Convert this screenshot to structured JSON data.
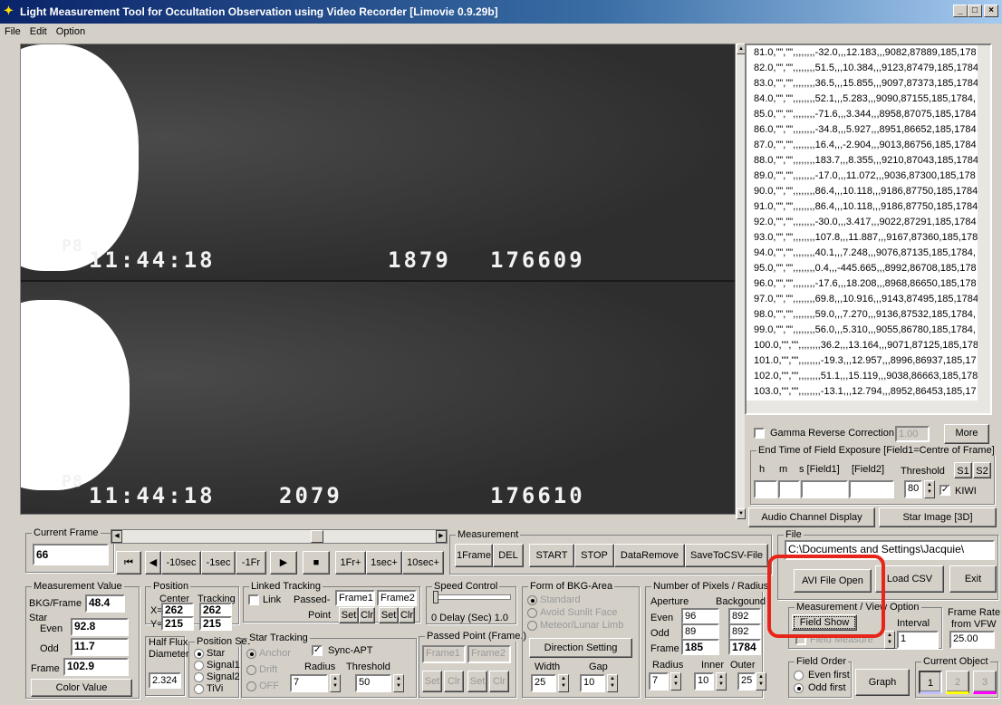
{
  "window": {
    "title": "Light Measurement Tool for Occultation Observation using Video Recorder [Limovie 0.9.29b]"
  },
  "menu": [
    "File",
    "Edit",
    "Option"
  ],
  "video": {
    "top": {
      "label": "P8",
      "time": "11:44:18",
      "n1": "1879",
      "n2": "176609"
    },
    "bottom": {
      "label": "P8",
      "time": "11:44:18",
      "n1": "2079",
      "n2": "176610"
    }
  },
  "log_rows": [
    "81.0,\"\",\"\",,,,,,,,-32.0,,,12.183,,,9082,87889,185,178",
    "82.0,\"\",\"\",,,,,,,,51.5,,,10.384,,,9123,87479,185,1784",
    "83.0,\"\",\"\",,,,,,,,36.5,,,15.855,,,9097,87373,185,1784",
    "84.0,\"\",\"\",,,,,,,,52.1,,,5.283,,,9090,87155,185,1784,",
    "85.0,\"\",\"\",,,,,,,,-71.6,,,3.344,,,8958,87075,185,1784",
    "86.0,\"\",\"\",,,,,,,,-34.8,,,5.927,,,8951,86652,185,1784",
    "87.0,\"\",\"\",,,,,,,,16.4,,,-2.904,,,9013,86756,185,1784",
    "88.0,\"\",\"\",,,,,,,,183.7,,,8.355,,,9210,87043,185,1784",
    "89.0,\"\",\"\",,,,,,,,-17.0,,,11.072,,,9036,87300,185,178",
    "90.0,\"\",\"\",,,,,,,,86.4,,,10.118,,,9186,87750,185,1784",
    "91.0,\"\",\"\",,,,,,,,86.4,,,10.118,,,9186,87750,185,1784",
    "92.0,\"\",\"\",,,,,,,,-30.0,,,3.417,,,9022,87291,185,1784",
    "93.0,\"\",\"\",,,,,,,,107.8,,,11.887,,,9167,87360,185,178",
    "94.0,\"\",\"\",,,,,,,,40.1,,,7.248,,,9076,87135,185,1784,",
    "95.0,\"\",\"\",,,,,,,,0.4,,,-445.665,,,8992,86708,185,178",
    "96.0,\"\",\"\",,,,,,,,-17.6,,,18.208,,,8968,86650,185,178",
    "97.0,\"\",\"\",,,,,,,,69.8,,,10.916,,,9143,87495,185,1784",
    "98.0,\"\",\"\",,,,,,,,59.0,,,7.270,,,9136,87532,185,1784,",
    "99.0,\"\",\"\",,,,,,,,56.0,,,5.310,,,9055,86780,185,1784,",
    "100.0,\"\",\"\",,,,,,,,36.2,,,13.164,,,9071,87125,185,178",
    "101.0,\"\",\"\",,,,,,,,-19.3,,,12.957,,,8996,86937,185,17",
    "102.0,\"\",\"\",,,,,,,,51.1,,,15.119,,,9038,86663,185,178",
    "103.0,\"\",\"\",,,,,,,,-13.1,,,12.794,,,8952,86453,185,17"
  ],
  "gamma": {
    "label": "Gamma Reverse Correction",
    "value": "1.00",
    "more": "More"
  },
  "endtime": {
    "caption": "End Time of Field Exposure [Field1=Centre of Frame]",
    "h": "h",
    "m": "m",
    "s": "s [Field1]",
    "f2": "[Field2]",
    "threshold_label": "Threshold",
    "threshold": "80",
    "s1": "S1",
    "s2": "S2",
    "kiwi": "KIWI"
  },
  "audio_btn": "Audio Channel Display",
  "star3d_btn": "Star Image [3D]",
  "current_frame": {
    "caption": "Current Frame",
    "value": "66"
  },
  "transport": [
    "⏮",
    "◀",
    "-10sec",
    "-1sec",
    "-1Fr",
    "▶",
    "■",
    "1Fr+",
    "1sec+",
    "10sec+"
  ],
  "measurement": {
    "caption": "Measurement",
    "buttons": [
      "1Frame",
      "DEL",
      "START",
      "STOP",
      "DataRemove",
      "SaveToCSV-File"
    ]
  },
  "file": {
    "caption": "File",
    "path": "C:\\Documents and Settings\\Jacquie\\",
    "avi": "AVI File Open",
    "csv": "Load CSV",
    "exit": "Exit"
  },
  "meas_value": {
    "caption": "Measurement Value",
    "bkg_label": "BKG/Frame",
    "bkg": "48.4",
    "star_label": "Star",
    "even_label": "Even",
    "even": "92.8",
    "odd_label": "Odd",
    "odd": "11.7",
    "frame_label": "Frame",
    "frame": "102.9",
    "color_btn": "Color Value"
  },
  "position": {
    "caption": "Position",
    "center": "Center",
    "tracking": "Tracking",
    "x_label": "X=",
    "x1": "262",
    "x2": "262",
    "y_label": "Y=",
    "y1": "215",
    "y2": "215"
  },
  "halfflux": {
    "label1": "Half Flux",
    "label2": "Diameter",
    "value": "2.324"
  },
  "posset": {
    "caption": "Position Set",
    "options": [
      "Star",
      "Signal1",
      "Signal2",
      "TiVi"
    ]
  },
  "linked": {
    "caption": "Linked Tracking",
    "link": "Link",
    "passed": "Passed-",
    "point": "Point",
    "frame1": "Frame1",
    "frame2": "Frame2",
    "set": "Set",
    "clr": "Clr"
  },
  "star_tracking": {
    "caption": "Star Tracking",
    "opts": [
      "Anchor",
      "Drift",
      "OFF"
    ],
    "sync": "Sync-APT",
    "radius_label": "Radius",
    "threshold_label": "Threshold",
    "radius": "7",
    "threshold": "50"
  },
  "speed": {
    "caption": "Speed Control",
    "delay": "0  Delay (Sec) 1.0"
  },
  "passed_point": {
    "caption": "Passed Point (Frame.)",
    "frame1": "Frame1",
    "frame2": "Frame2",
    "set": "Set",
    "clr": "Clr"
  },
  "bkg_area": {
    "caption": "Form of BKG-Area",
    "opts": [
      "Standard",
      "Avoid Sunlit Face",
      "Meteor/Lunar Limb"
    ],
    "dir_btn": "Direction Setting",
    "width_label": "Width",
    "gap_label": "Gap",
    "width": "25",
    "gap": "10"
  },
  "pixels": {
    "caption": "Number of Pixels / Radius",
    "aperture": "Aperture",
    "background": "Backgound",
    "even_label": "Even",
    "even_a": "96",
    "even_b": "892",
    "odd_label": "Odd",
    "odd_a": "89",
    "odd_b": "892",
    "frame_label": "Frame",
    "frame_a": "185",
    "frame_b": "1784",
    "radius_label": "Radius",
    "inner_label": "Inner",
    "outer_label": "Outer",
    "radius": "7",
    "inner": "10",
    "outer": "25"
  },
  "view": {
    "caption": "Measurement / View Option",
    "field_show": "Field Show",
    "field_measure": "Field Measure",
    "interval_label": "Interval",
    "interval": "1"
  },
  "framerate": {
    "label1": "Frame Rate",
    "label2": "from VFW",
    "value": "25.00"
  },
  "field_order": {
    "caption": "Field Order",
    "even": "Even first",
    "odd": "Odd first",
    "graph": "Graph"
  },
  "current_object": {
    "caption": "Current Object",
    "items": [
      "1",
      "2",
      "3"
    ]
  },
  "colors": {
    "highlight": "#e8251a",
    "title_start": "#0a246a",
    "obj2": "#ffff00",
    "obj3": "#ff00ff"
  }
}
